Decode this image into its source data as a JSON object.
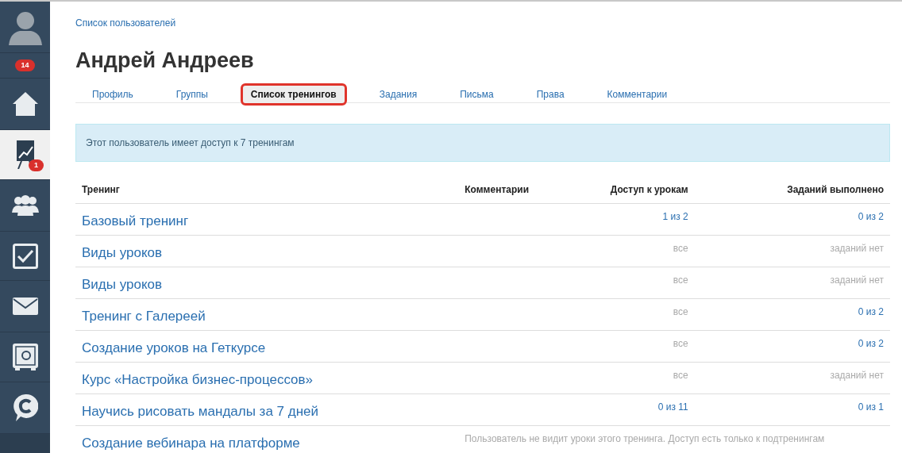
{
  "sidebar": {
    "items": [
      {
        "kind": "avatar",
        "selected": false
      },
      {
        "kind": "badge-row",
        "selected": false,
        "badge": "14"
      },
      {
        "kind": "home",
        "selected": false
      },
      {
        "kind": "trainings",
        "selected": true,
        "badge": "1"
      },
      {
        "kind": "people",
        "selected": false
      },
      {
        "kind": "tasks",
        "selected": false
      },
      {
        "kind": "mail",
        "selected": false
      },
      {
        "kind": "safe",
        "selected": false
      },
      {
        "kind": "chat",
        "selected": false
      }
    ]
  },
  "breadcrumb": "Список пользователей",
  "title": "Андрей Андреев",
  "tabs": [
    {
      "label": "Профиль",
      "selected": false
    },
    {
      "label": "Группы",
      "selected": false
    },
    {
      "label": "Список тренингов",
      "selected": true
    },
    {
      "label": "Задания",
      "selected": false
    },
    {
      "label": "Письма",
      "selected": false
    },
    {
      "label": "Права",
      "selected": false
    },
    {
      "label": "Комментарии",
      "selected": false
    }
  ],
  "alert": "Этот пользователь имеет доступ к 7 тренингам",
  "table": {
    "columns": [
      "Тренинг",
      "Комментарии",
      "Доступ к урокам",
      "Заданий выполнено"
    ],
    "rows": [
      {
        "training": "Базовый тренинг",
        "access": {
          "text": "1 из 2",
          "kind": "link"
        },
        "tasks": {
          "text": "0 из 2",
          "kind": "link"
        }
      },
      {
        "training": "Виды уроков",
        "access": {
          "text": "все",
          "kind": "muted"
        },
        "tasks": {
          "text": "заданий нет",
          "kind": "muted"
        }
      },
      {
        "training": "Виды уроков",
        "access": {
          "text": "все",
          "kind": "muted"
        },
        "tasks": {
          "text": "заданий нет",
          "kind": "muted"
        }
      },
      {
        "training": "Тренинг с Галереей",
        "access": {
          "text": "все",
          "kind": "muted"
        },
        "tasks": {
          "text": "0 из 2",
          "kind": "link"
        }
      },
      {
        "training": "Создание уроков на Геткурсе",
        "access": {
          "text": "все",
          "kind": "muted"
        },
        "tasks": {
          "text": "0 из 2",
          "kind": "link"
        }
      },
      {
        "training": "Курс «Настройка бизнес-процессов»",
        "access": {
          "text": "все",
          "kind": "muted"
        },
        "tasks": {
          "text": "заданий нет",
          "kind": "muted"
        }
      },
      {
        "training": "Научись рисовать мандалы за 7 дней",
        "access": {
          "text": "0 из 11",
          "kind": "link"
        },
        "tasks": {
          "text": "0 из 1",
          "kind": "link"
        }
      },
      {
        "training": "Создание вебинара на платформе",
        "note": "Пользователь не видит уроки этого тренинга. Доступ есть только к подтренингам"
      }
    ]
  }
}
